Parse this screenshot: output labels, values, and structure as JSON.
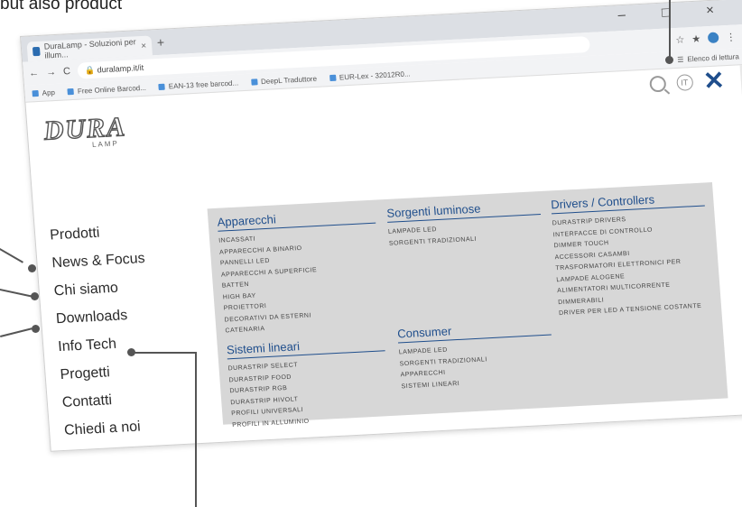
{
  "doc_text": "but also product",
  "browser": {
    "tab_title": "DuraLamp - Soluzioni per illum...",
    "tab_close": "×",
    "new_tab": "+",
    "window_controls": "–  □  ×",
    "url": "duralamp.it/it",
    "bookmarks": [
      {
        "label": "App"
      },
      {
        "label": "Free Online Barcod..."
      },
      {
        "label": "EAN-13 free barcod..."
      },
      {
        "label": "DeepL Traduttore"
      },
      {
        "label": "EUR-Lex - 32012R0..."
      }
    ],
    "reading_list": "Elenco di lettura"
  },
  "site": {
    "logo": "DURA",
    "logo_sub": "LAMP",
    "lang_label": "IT"
  },
  "menu": [
    "Prodotti",
    "News & Focus",
    "Chi siamo",
    "Downloads",
    "Info Tech",
    "Progetti",
    "Contatti",
    "Chiedi a noi"
  ],
  "mega": {
    "apparecchi": {
      "title": "Apparecchi",
      "items": [
        "Incassati",
        "Apparecchi a binario",
        "Pannelli LED",
        "Apparecchi a superficie",
        "Batten",
        "High Bay",
        "Proiettori",
        "Decorativi da esterni",
        "Catenaria"
      ]
    },
    "sorgenti": {
      "title": "Sorgenti luminose",
      "items": [
        "Lampade LED",
        "Sorgenti tradizionali"
      ]
    },
    "drivers": {
      "title": "Drivers / Controllers",
      "items": [
        "Durastrip drivers",
        "Interfacce di controllo",
        "Dimmer touch",
        "Accessori Casambi",
        "Trasformatori elettronici per lampade alogene",
        "Alimentatori multicorrente dimmerabili",
        "Driver per LED a tensione costante"
      ]
    },
    "sistemi": {
      "title": "Sistemi lineari",
      "items": [
        "Durastrip Select",
        "Durastrip Food",
        "Durastrip RGB",
        "Durastrip HiVolt",
        "Profili universali",
        "Profili in alluminio"
      ]
    },
    "consumer": {
      "title": "Consumer",
      "items": [
        "Lampade LED",
        "Sorgenti tradizionali",
        "Apparecchi",
        "Sistemi lineari"
      ]
    }
  }
}
